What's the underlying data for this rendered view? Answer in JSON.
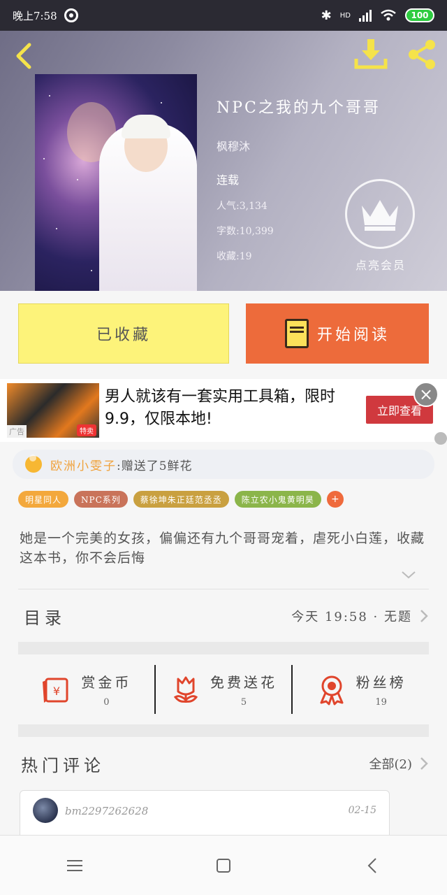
{
  "status_bar": {
    "time": "晚上7:58",
    "battery": "100",
    "network": "HD"
  },
  "book": {
    "title": "NPC之我的九个哥哥",
    "author": "枫穆沐",
    "status": "连载",
    "popularity": "人气:3,134",
    "word_count": "字数:10,399",
    "favorites": "收藏:19",
    "vip_label": "点亮会员"
  },
  "actions": {
    "collected_label": "已收藏",
    "read_label": "开始阅读"
  },
  "ad": {
    "text": "男人就该有一套实用工具箱，限时9.9，仅限本地!",
    "tag": "广告",
    "badge": "特卖",
    "cta": "立即查看"
  },
  "gift": {
    "user": "欧洲小雯子",
    "message": ":赠送了5鲜花"
  },
  "tags": [
    {
      "label": "明星同人",
      "color": "#f3a83c"
    },
    {
      "label": "NPC系列",
      "color": "#c9735a"
    },
    {
      "label": "蔡徐坤朱正廷范丞丞",
      "color": "#c9a040"
    },
    {
      "label": "陈立农小鬼黄明昊",
      "color": "#8bb54a"
    }
  ],
  "tags_more": "+",
  "intro": "她是一个完美的女孩，偏偏还有九个哥哥宠着，虐死小白莲，收藏这本书，你不会后悔",
  "catalog": {
    "title": "目录",
    "latest": "今天 19:58 · 无题"
  },
  "stats": [
    {
      "label": "赏金币",
      "value": "0",
      "icon": "reward-coin-icon"
    },
    {
      "label": "免费送花",
      "value": "5",
      "icon": "flower-icon"
    },
    {
      "label": "粉丝榜",
      "value": "19",
      "icon": "award-badge-icon"
    }
  ],
  "comments": {
    "title": "热门评论",
    "all_label": "全部(2)",
    "items": [
      {
        "user": "bm2297262628",
        "date": "02-15"
      }
    ]
  },
  "colors": {
    "accent_orange": "#ed6b3b",
    "collected_yellow": "#fdf37a",
    "icon_red": "#e0452c"
  }
}
